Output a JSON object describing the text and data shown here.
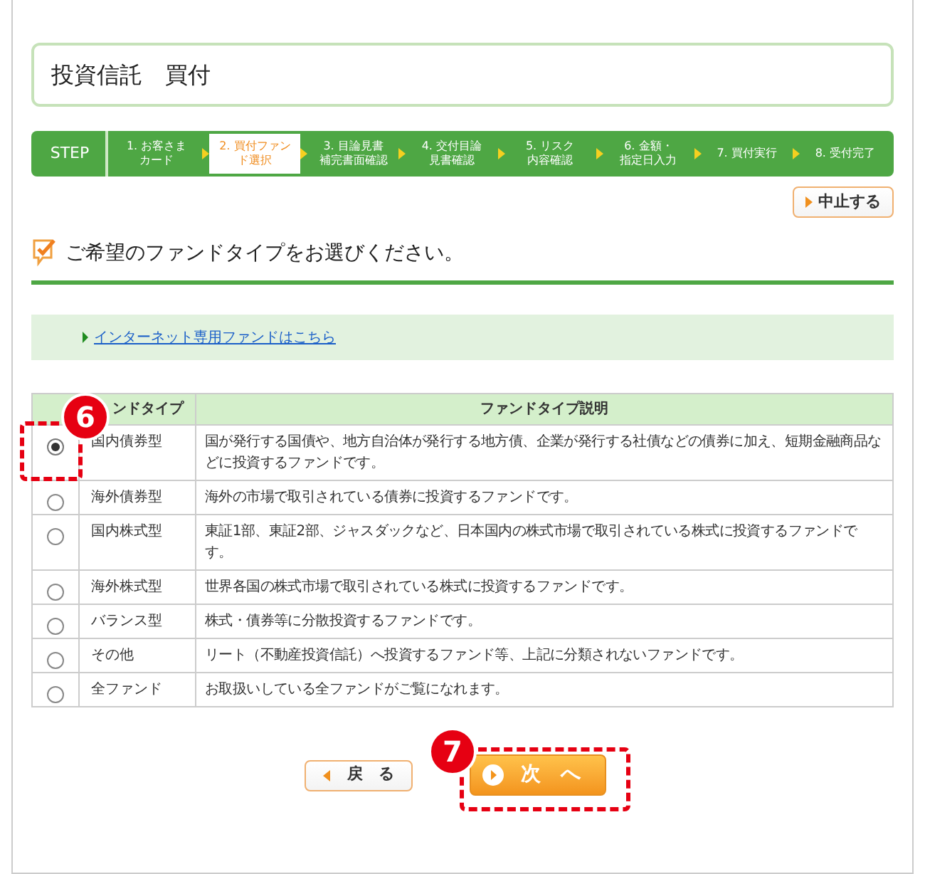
{
  "page_title": "投資信託　買付",
  "steps": {
    "label": "STEP",
    "items": [
      {
        "lines": [
          "1. お客さま",
          "カード"
        ],
        "selected": false
      },
      {
        "lines": [
          "2. 買付ファン",
          "ド選択"
        ],
        "selected": true
      },
      {
        "lines": [
          "3. 目論見書",
          "補完書面確認"
        ],
        "selected": false
      },
      {
        "lines": [
          "4. 交付目論",
          "見書確認"
        ],
        "selected": false
      },
      {
        "lines": [
          "5. リスク",
          "内容確認"
        ],
        "selected": false
      },
      {
        "lines": [
          "6. 金額・",
          "指定日入力"
        ],
        "selected": false
      },
      {
        "lines": [
          "7. 買付実行"
        ],
        "selected": false
      },
      {
        "lines": [
          "8. 受付完了"
        ],
        "selected": false
      }
    ]
  },
  "cancel_button": "中止する",
  "heading": "ご希望のファンドタイプをお選びください。",
  "internet_link": "インターネット専用ファンドはこちら",
  "table": {
    "columns": [
      "ンドタイプ",
      "ファンドタイプ説明"
    ],
    "rows": [
      {
        "type": "国内債券型",
        "description": "国が発行する国債や、地方自治体が発行する地方債、企業が発行する社債などの債券に加え、短期金融商品などに投資するファンドです。",
        "selected": true
      },
      {
        "type": "海外債券型",
        "description": "海外の市場で取引されている債券に投資するファンドです。",
        "selected": false
      },
      {
        "type": "国内株式型",
        "description": "東証1部、東証2部、ジャスダックなど、日本国内の株式市場で取引されている株式に投資するファンドです。",
        "selected": false
      },
      {
        "type": "海外株式型",
        "description": "世界各国の株式市場で取引されている株式に投資するファンドです。",
        "selected": false
      },
      {
        "type": "バランス型",
        "description": "株式・債券等に分散投資するファンドです。",
        "selected": false
      },
      {
        "type": "その他",
        "description": "リート（不動産投資信託）へ投資するファンド等、上記に分類されないファンドです。",
        "selected": false
      },
      {
        "type": "全ファンド",
        "description": "お取扱いしている全ファンドがご覧になれます。",
        "selected": false
      }
    ]
  },
  "back_button": "戻　る",
  "next_button": "次　へ",
  "annotations": [
    {
      "number": "6"
    },
    {
      "number": "7"
    }
  ]
}
